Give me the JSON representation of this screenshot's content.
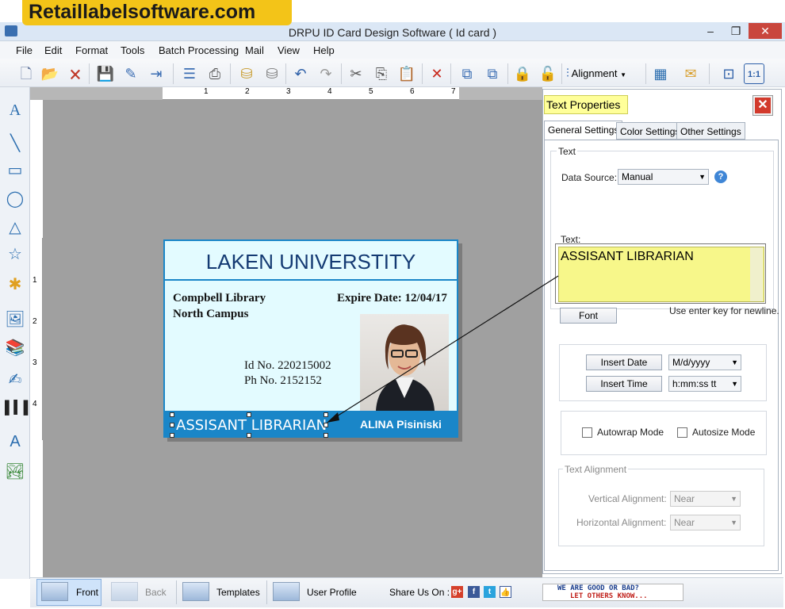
{
  "banner": "Retaillabelsoftware.com",
  "window": {
    "title": "DRPU ID Card Design Software ( Id card )",
    "min": "–",
    "max": "❐",
    "close": "✕"
  },
  "menu": [
    "File",
    "Edit",
    "Format",
    "Tools",
    "Batch Processing",
    "Mail",
    "View",
    "Help"
  ],
  "toolbar": {
    "alignment_label": "Alignment"
  },
  "ruler": {
    "marks": [
      "1",
      "2",
      "3",
      "4",
      "5",
      "6",
      "7"
    ],
    "vmarks": [
      "1",
      "2",
      "3",
      "4"
    ]
  },
  "card": {
    "title": "LAKEN UNIVERSTITY",
    "library": "Compbell Library",
    "campus": "North Campus",
    "expire": "Expire Date: 12/04/17",
    "id_no": "Id No. 220215002",
    "ph_no": "Ph No. 2152152",
    "designation": "ASSISANT LIBRARIAN",
    "name": "ALINA Pisiniski",
    "colors": {
      "header_border": "#1a86c8",
      "footer_bg": "#1a86c8",
      "card_bg": "#e3fbff",
      "title_color": "#143a73"
    }
  },
  "props": {
    "title": "Text Properties",
    "close": "✕",
    "tabs": [
      "General Settings",
      "Color Settings",
      "Other Settings"
    ],
    "group_text": "Text",
    "data_source_label": "Data Source:",
    "data_source_value": "Manual",
    "help": "?",
    "text_label": "Text:",
    "text_value": "ASSISANT LIBRARIAN",
    "font_button": "Font",
    "hint": "Use enter key for newline.",
    "insert_date": "Insert Date",
    "date_format": "M/d/yyyy",
    "insert_time": "Insert Time",
    "time_format": "h:mm:ss tt",
    "autowrap": "Autowrap Mode",
    "autosize": "Autosize Mode",
    "alignment_group": "Text Alignment",
    "vertical_label": "Vertical Alignment:",
    "vertical_value": "Near",
    "horizontal_label": "Horizontal  Alignment:",
    "horizontal_value": "Near"
  },
  "status": {
    "front": "Front",
    "back": "Back",
    "templates": "Templates",
    "user_profile": "User Profile",
    "share": "Share Us On :",
    "feedback_line1": "WE ARE GOOD OR BAD?",
    "feedback_line2": "LET OTHERS KNOW..."
  }
}
